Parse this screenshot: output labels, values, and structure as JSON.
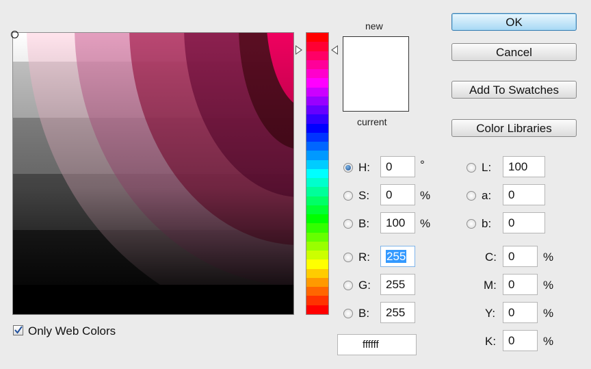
{
  "colors": {
    "accent": "#3399ff",
    "new_color": "#ffffff",
    "current_color": "#ffffff"
  },
  "field_marker_icon": "color-field-marker-icon",
  "field_palette": {
    "base_grays": [
      "#ffffff",
      "#cccccc",
      "#999999",
      "#666666",
      "#333333",
      "#000000"
    ],
    "bands": [
      [
        "#ffccff",
        "#ffccdd",
        "#ffcccc",
        "#ff99cc",
        "#ff6699",
        "#ff3366",
        "#ff0066"
      ],
      [
        "#cc99cc",
        "#cc9999",
        "#cc6699",
        "#cc3366",
        "#cc0033"
      ],
      [
        "#996699",
        "#996666",
        "#993366",
        "#990033"
      ],
      [
        "#663366",
        "#663333",
        "#660033"
      ],
      [
        "#330033",
        "#330000"
      ]
    ]
  },
  "hue_strip_colors": [
    "#ff0000",
    "#ff0033",
    "#ff0066",
    "#ff0099",
    "#ff00cc",
    "#ff00ff",
    "#cc00ff",
    "#9900ff",
    "#6600ff",
    "#3300ff",
    "#0000ff",
    "#0033ff",
    "#0066ff",
    "#0099ff",
    "#00ccff",
    "#00ffff",
    "#00ffcc",
    "#00ff99",
    "#00ff66",
    "#00ff33",
    "#00ff00",
    "#33ff00",
    "#66ff00",
    "#99ff00",
    "#ccff00",
    "#ffff00",
    "#ffcc00",
    "#ff9900",
    "#ff6600",
    "#ff3300",
    "#ff0000"
  ],
  "preview": {
    "new_label": "new",
    "current_label": "current"
  },
  "buttons": {
    "ok": "OK",
    "cancel": "Cancel",
    "add_to_swatches": "Add To Swatches",
    "color_libraries": "Color Libraries"
  },
  "hsb": {
    "h": {
      "label": "H:",
      "value": "0",
      "unit": "°",
      "checked": true
    },
    "s": {
      "label": "S:",
      "value": "0",
      "unit": "%"
    },
    "b": {
      "label": "B:",
      "value": "100",
      "unit": "%"
    }
  },
  "rgb": {
    "r": {
      "label": "R:",
      "value": "255"
    },
    "g": {
      "label": "G:",
      "value": "255"
    },
    "b": {
      "label": "B:",
      "value": "255"
    }
  },
  "lab": {
    "l": {
      "label": "L:",
      "value": "100"
    },
    "a": {
      "label": "a:",
      "value": "0"
    },
    "b": {
      "label": "b:",
      "value": "0"
    }
  },
  "cmyk": {
    "c": {
      "label": "C:",
      "value": "0",
      "unit": "%"
    },
    "m": {
      "label": "M:",
      "value": "0",
      "unit": "%"
    },
    "y": {
      "label": "Y:",
      "value": "0",
      "unit": "%"
    },
    "k": {
      "label": "K:",
      "value": "0",
      "unit": "%"
    }
  },
  "hex": {
    "label": "#",
    "value": "ffffff"
  },
  "web_colors": {
    "label": "Only Web Colors",
    "checked": true
  }
}
